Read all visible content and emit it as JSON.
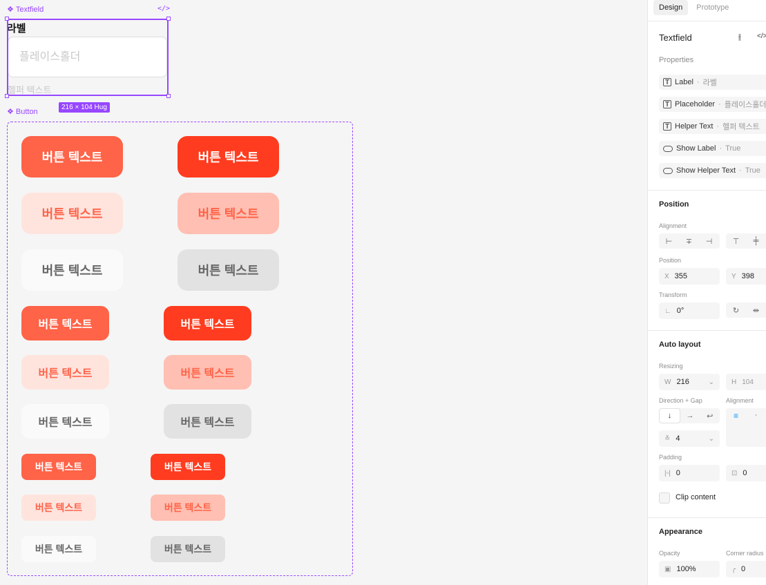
{
  "canvas": {
    "textfield": {
      "component_label": "Textfield",
      "label": "라벨",
      "placeholder": "플레이스홀더",
      "helper_text": "헬퍼 텍스트",
      "size_badge": "216 × 104 Hug"
    },
    "button": {
      "component_label": "Button",
      "text": "버튼 텍스트"
    }
  },
  "panel": {
    "tabs": [
      "Design",
      "Prototype"
    ],
    "component_name": "Textfield",
    "properties_title": "Properties",
    "properties": [
      {
        "name": "Label",
        "value": "라벨",
        "icon": "text-icon"
      },
      {
        "name": "Placeholder",
        "value": "플레이스홀더",
        "icon": "text-icon"
      },
      {
        "name": "Helper Text",
        "value": "헬퍼 텍스트",
        "icon": "text-icon"
      },
      {
        "name": "Show Label",
        "value": "True",
        "icon": "toggle-icon"
      },
      {
        "name": "Show Helper Text",
        "value": "True",
        "icon": "toggle-icon"
      }
    ],
    "position": {
      "title": "Position",
      "alignment_label": "Alignment",
      "position_label": "Position",
      "x_label": "X",
      "x": "355",
      "y_label": "Y",
      "y": "398",
      "transform_label": "Transform",
      "rotation": "0°"
    },
    "auto_layout": {
      "title": "Auto layout",
      "resizing_label": "Resizing",
      "w_label": "W",
      "w": "216",
      "h_label": "H",
      "h": "104",
      "direction_label": "Direction + Gap",
      "alignment_label": "Alignment",
      "gap": "4",
      "padding_label": "Padding",
      "padding_h": "0",
      "padding_v": "0",
      "clip_label": "Clip content"
    },
    "appearance": {
      "title": "Appearance",
      "opacity_label": "Opacity",
      "opacity": "100%",
      "radius_label": "Corner radius",
      "radius": "0"
    }
  }
}
